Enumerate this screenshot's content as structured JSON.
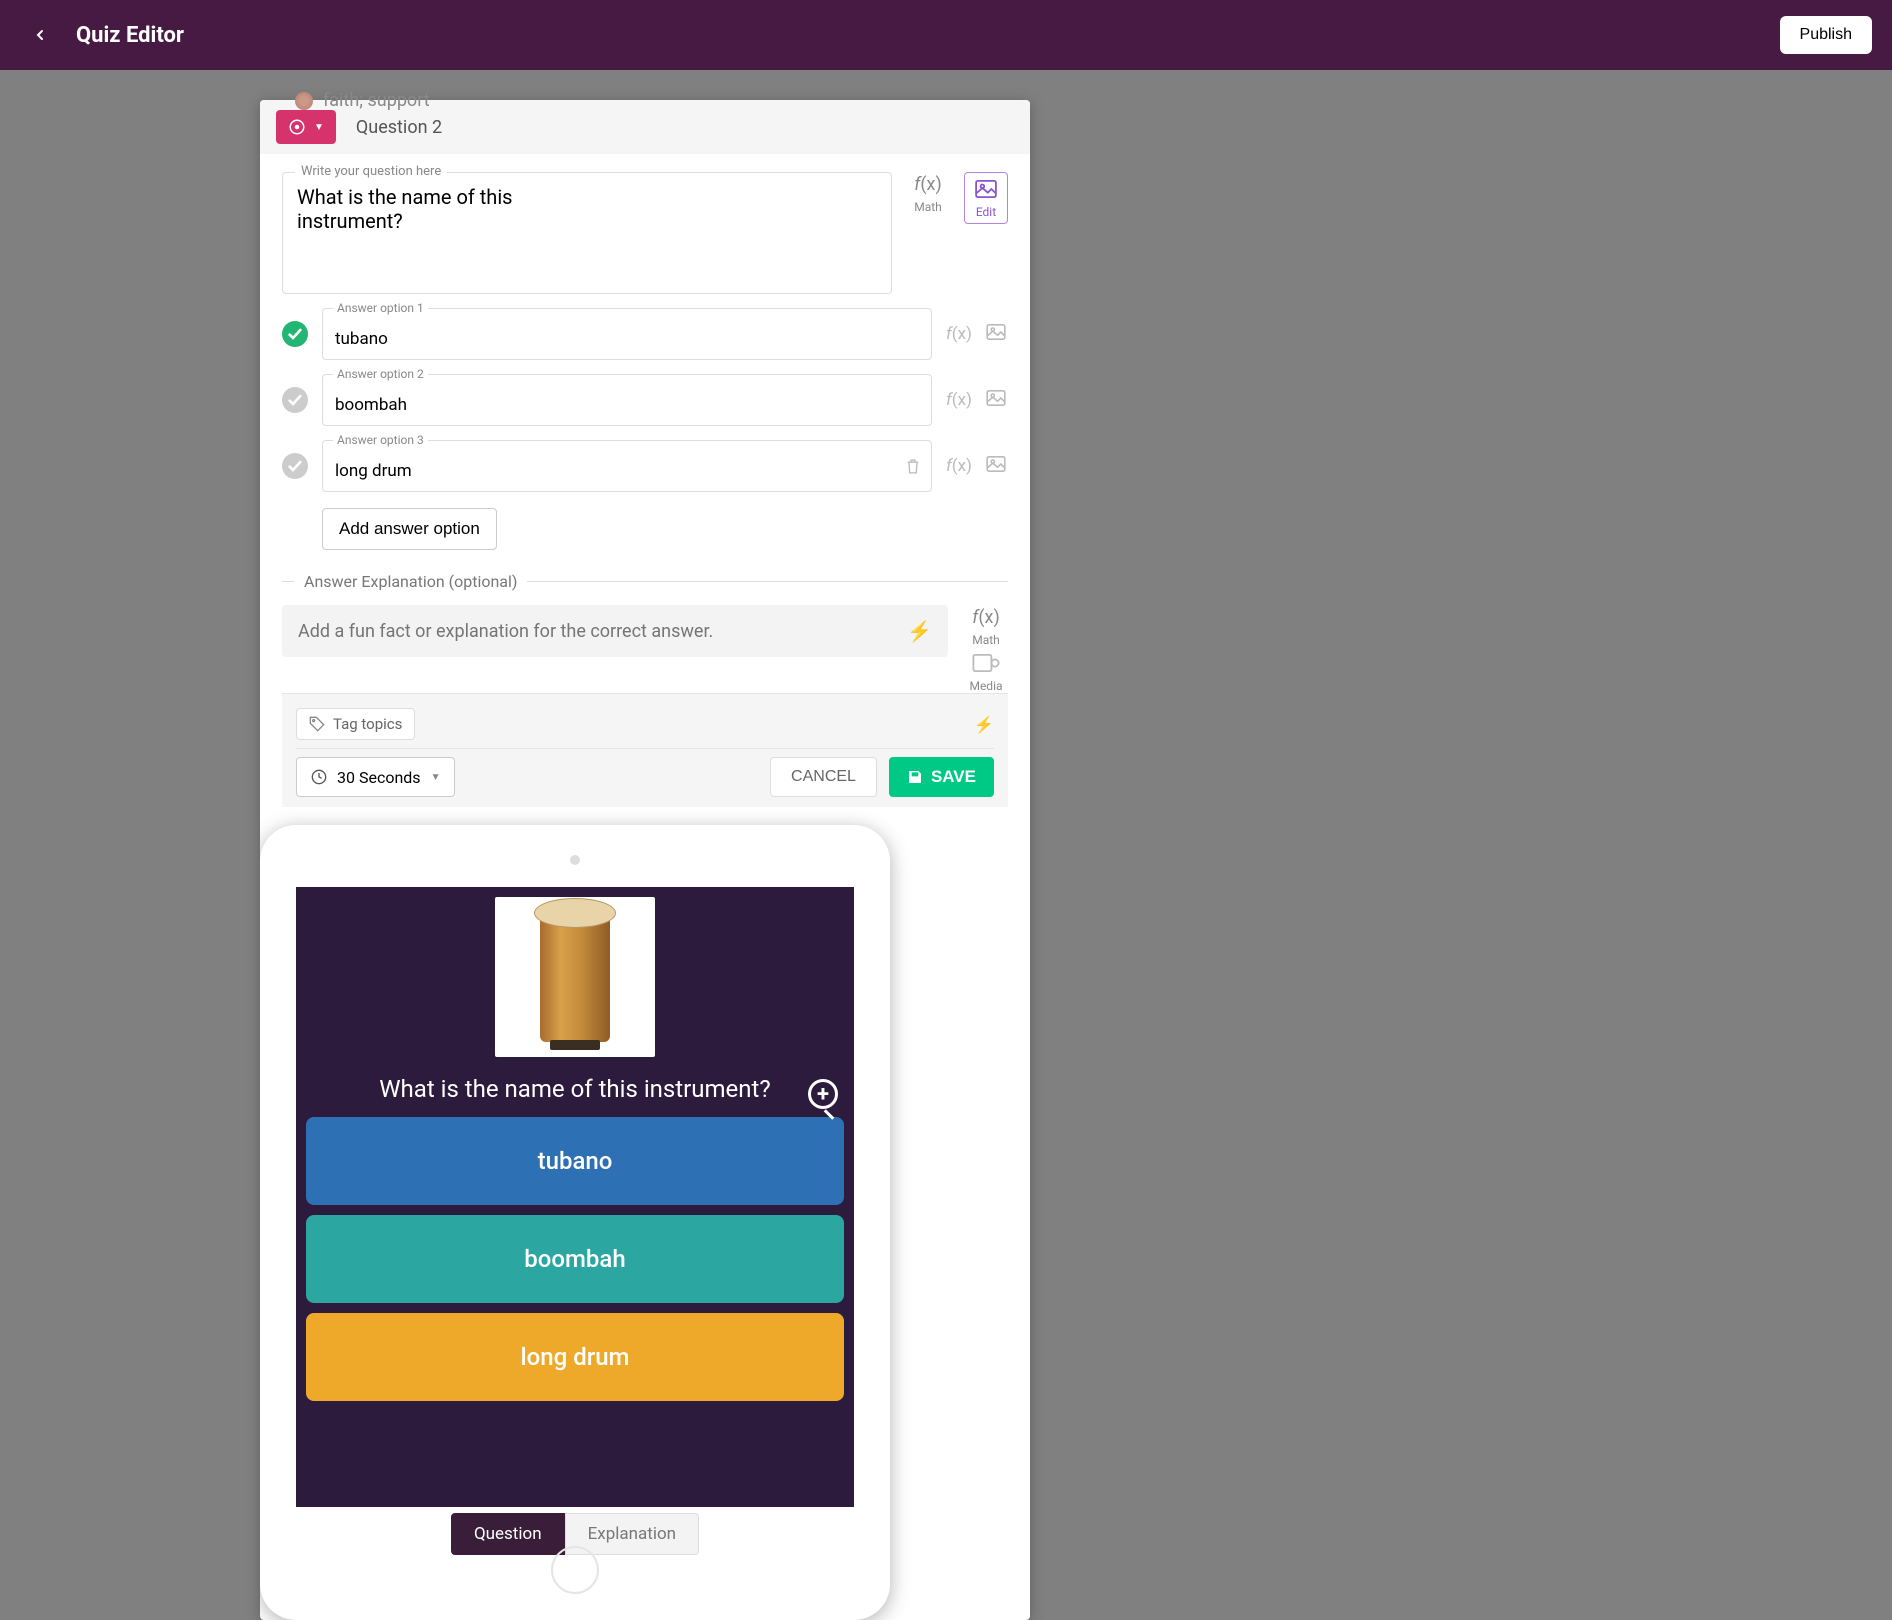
{
  "header": {
    "title": "Quiz Editor",
    "publish": "Publish"
  },
  "ghost": {
    "text": "faith; support"
  },
  "editor": {
    "question_number": "Question 2",
    "question_legend": "Write your question here",
    "question_text": "What is the name of this instrument?",
    "math_label": "Math",
    "edit_label": "Edit",
    "options": [
      {
        "label": "Answer option 1",
        "value": "tubano",
        "correct": true
      },
      {
        "label": "Answer option 2",
        "value": "boombah",
        "correct": false
      },
      {
        "label": "Answer option 3",
        "value": "long drum",
        "correct": false
      }
    ],
    "add_option": "Add answer option",
    "explanation_heading": "Answer Explanation (optional)",
    "explanation_placeholder": "Add a fun fact or explanation for the correct answer.",
    "media_label": "Media",
    "tag_topics": "Tag topics",
    "time_value": "30 Seconds",
    "cancel": "CANCEL",
    "save": "SAVE"
  },
  "preview": {
    "question": "What is the name of this instrument?",
    "choices": [
      "tubano",
      "boombah",
      "long drum"
    ],
    "tab_question": "Question",
    "tab_explanation": "Explanation"
  }
}
